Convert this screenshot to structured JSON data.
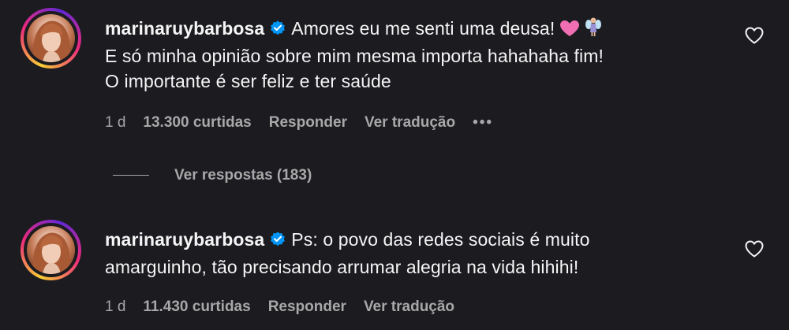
{
  "comments": [
    {
      "username": "marinaruybarbosa",
      "text_line1": "Amores eu me senti uma deusa!",
      "text_line2": "E só minha opinião sobre mim mesma importa hahahaha fim!",
      "text_line3": "O importante é ser feliz e ter saúde",
      "emojis": [
        "pink-heart-icon",
        "fairy-icon"
      ],
      "time": "1 d",
      "likes": "13.300 curtidas",
      "reply_label": "Responder",
      "translate_label": "Ver tradução",
      "more_label": "•••"
    },
    {
      "username": "marinaruybarbosa",
      "text_line1": "Ps: o povo das redes sociais é muito",
      "text_line2": "amarguinho, tão precisando arrumar alegria na vida hihihi!",
      "time": "1 d",
      "likes": "11.430 curtidas",
      "reply_label": "Responder",
      "translate_label": "Ver tradução"
    }
  ],
  "view_replies": "Ver respostas (183)",
  "colors": {
    "background": "#1b1b20",
    "text": "#f5f5f5",
    "secondary": "#a8a8a8",
    "verified": "#0095f6"
  }
}
